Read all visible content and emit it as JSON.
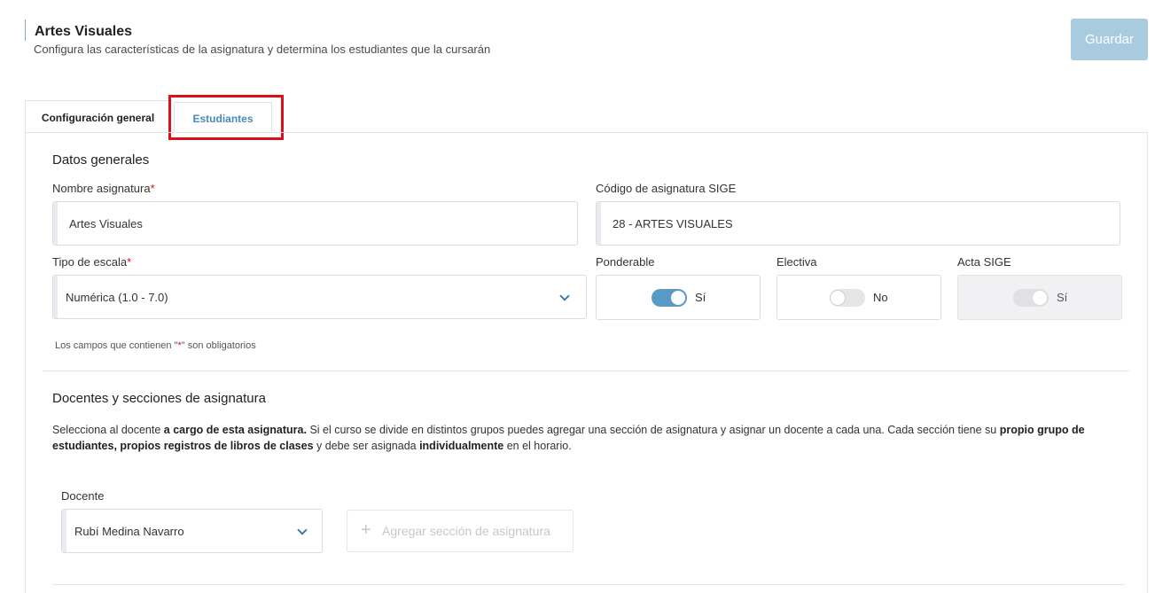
{
  "header": {
    "title": "Artes Visuales",
    "subtitle": "Configura las características de la asignatura y determina los estudiantes que la cursarán",
    "save_label": "Guardar"
  },
  "tabs": [
    {
      "label": "Configuración general",
      "active": true
    },
    {
      "label": "Estudiantes",
      "active": false
    }
  ],
  "general": {
    "section_title": "Datos generales",
    "name_label": "Nombre asignatura",
    "name_value": "Artes Visuales",
    "sige_label": "Código de asignatura SIGE",
    "sige_value": "28 - ARTES VISUALES",
    "scale_label": "Tipo de escala",
    "scale_value": "Numérica (1.0 - 7.0)",
    "required_mark": "*",
    "ponderable": {
      "label": "Ponderable",
      "state": "Sí",
      "on": true
    },
    "electiva": {
      "label": "Electiva",
      "state": "No",
      "on": false
    },
    "acta": {
      "label": "Acta SIGE",
      "state": "Sí",
      "on": true,
      "disabled": true
    },
    "hint_prefix": "Los campos que contienen \"",
    "hint_mark": "*",
    "hint_suffix": "\" son obligatorios"
  },
  "teachers": {
    "section_title": "Docentes y secciones de asignatura",
    "desc": {
      "p1": "Selecciona al docente ",
      "b1": "a cargo de esta asignatura.",
      "p2": " Si el curso se divide en distintos grupos puedes agregar una sección de asignatura y asignar un docente a cada una. Cada sección tiene su ",
      "b2": "propio grupo de estudiantes, propios registros de libros de clases",
      "p3": " y debe ser asignada ",
      "b3": "individualmente",
      "p4": " en el horario."
    },
    "docente_label": "Docente",
    "docente_value": "Rubí Medina Navarro",
    "add_section_label": "Agregar sección de asignatura",
    "add_icon": "+"
  },
  "colors": {
    "accent": "#5a9bc6",
    "save_button": "#a8cbe0",
    "highlight": "#d9101e",
    "required": "#d9101e"
  }
}
